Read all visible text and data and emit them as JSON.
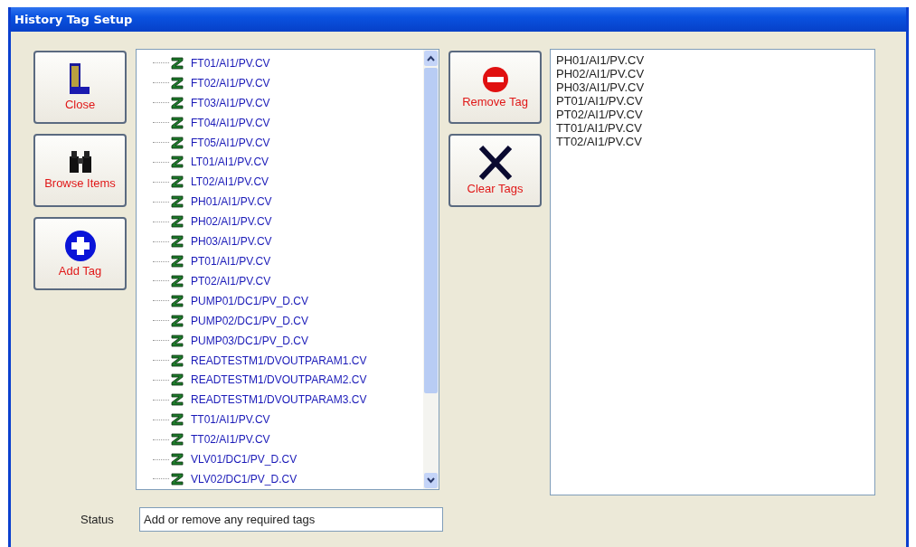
{
  "window": {
    "title": "History Tag Setup"
  },
  "left_buttons": [
    {
      "kind": "close",
      "label": "Close"
    },
    {
      "kind": "browse",
      "label": "Browse Items"
    },
    {
      "kind": "add",
      "label": "Add Tag"
    }
  ],
  "tree": {
    "items": [
      "FT01/AI1/PV.CV",
      "FT02/AI1/PV.CV",
      "FT03/AI1/PV.CV",
      "FT04/AI1/PV.CV",
      "FT05/AI1/PV.CV",
      "LT01/AI1/PV.CV",
      "LT02/AI1/PV.CV",
      "PH01/AI1/PV.CV",
      "PH02/AI1/PV.CV",
      "PH03/AI1/PV.CV",
      "PT01/AI1/PV.CV",
      "PT02/AI1/PV.CV",
      "PUMP01/DC1/PV_D.CV",
      "PUMP02/DC1/PV_D.CV",
      "PUMP03/DC1/PV_D.CV",
      "READTESTM1/DVOUTPARAM1.CV",
      "READTESTM1/DVOUTPARAM2.CV",
      "READTESTM1/DVOUTPARAM3.CV",
      "TT01/AI1/PV.CV",
      "TT02/AI1/PV.CV",
      "VLV01/DC1/PV_D.CV",
      "VLV02/DC1/PV_D.CV"
    ]
  },
  "right_buttons": [
    {
      "kind": "remove",
      "label": "Remove Tag"
    },
    {
      "kind": "clear",
      "label": "Clear Tags"
    }
  ],
  "selected_tags": [
    "PH01/AI1/PV.CV",
    "PH02/AI1/PV.CV",
    "PH03/AI1/PV.CV",
    "PT01/AI1/PV.CV",
    "PT02/AI1/PV.CV",
    "TT01/AI1/PV.CV",
    "TT02/AI1/PV.CV"
  ],
  "status": {
    "label": "Status",
    "value": "Add or remove any required tags"
  }
}
